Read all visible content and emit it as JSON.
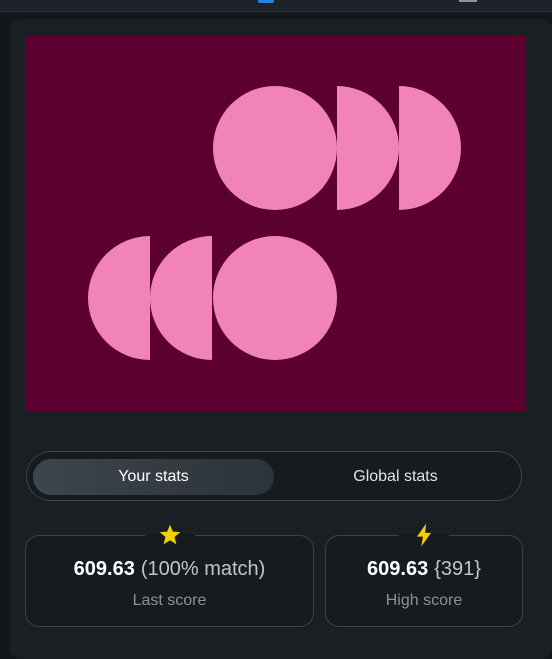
{
  "colors": {
    "canvas_bg": "#5c0030",
    "shape_fill": "#f283b6",
    "star_color": "#f5d000",
    "bolt_color": "#f5d000"
  },
  "tabs": [
    {
      "label": "Your stats",
      "active": true
    },
    {
      "label": "Global stats",
      "active": false
    }
  ],
  "last_score": {
    "icon": "star-icon",
    "value": "609.63",
    "extra": "(100% match)",
    "label": "Last score"
  },
  "high_score": {
    "icon": "lightning-icon",
    "value": "609.63",
    "extra": "{391}",
    "label": "High score"
  }
}
